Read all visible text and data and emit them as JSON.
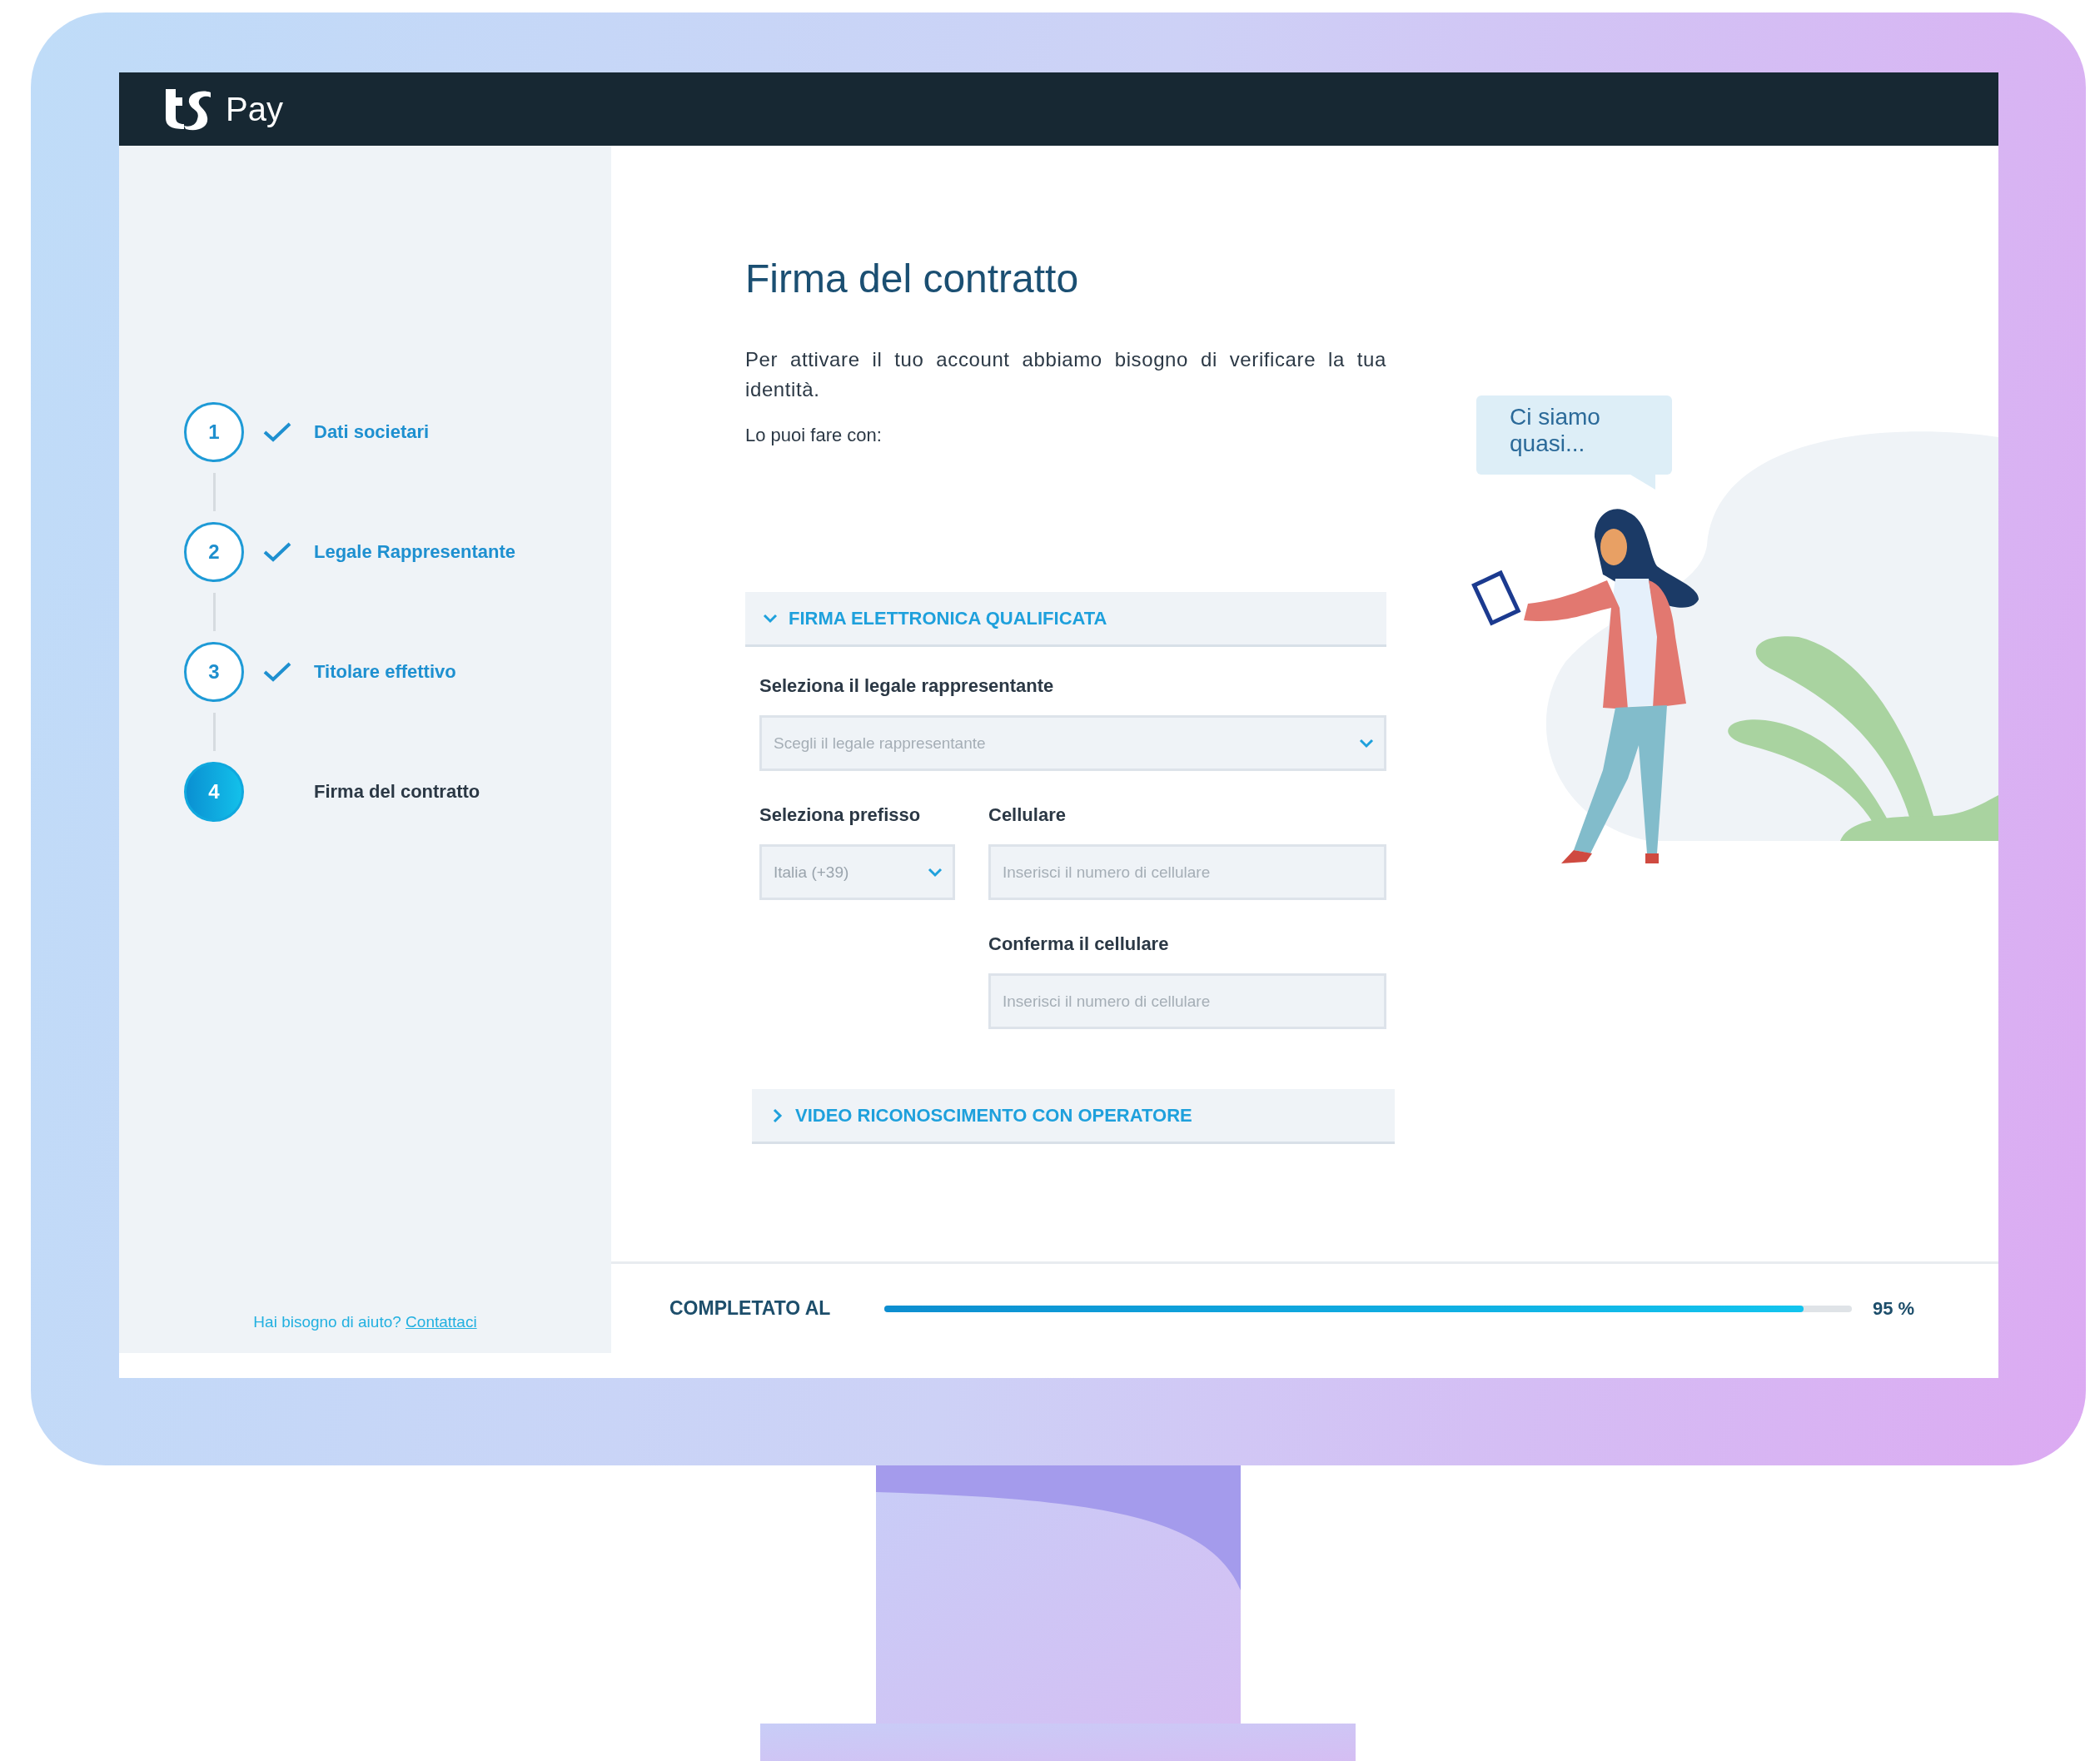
{
  "header": {
    "brand": "Pay"
  },
  "steps": [
    {
      "number": "1",
      "label": "Dati societari",
      "done": true,
      "selected": false
    },
    {
      "number": "2",
      "label": "Legale Rappresentante",
      "done": true,
      "selected": false
    },
    {
      "number": "3",
      "label": "Titolare effettivo",
      "done": true,
      "selected": false
    },
    {
      "number": "4",
      "label": "Firma del contratto",
      "done": false,
      "selected": true
    }
  ],
  "help": {
    "text": "Hai bisogno di aiuto?",
    "link": "Contattaci"
  },
  "page": {
    "title": "Firma del contratto",
    "intro": "Per attivare il tuo account abbiamo bisogno di verificare la tua identità.",
    "prompt": "Lo puoi fare con:"
  },
  "sections": [
    {
      "title": "FIRMA ELETTRONICA QUALIFICATA",
      "expanded": true,
      "representative": {
        "label": "Seleziona il legale rappresentante",
        "placeholder": "Scegli il legale rappresentante"
      },
      "prefix": {
        "label": "Seleziona prefisso",
        "value": "Italia (+39)"
      },
      "phone": {
        "label": "Cellulare",
        "placeholder": "Inserisci il numero di cellulare"
      },
      "confirm": {
        "label": "Conferma il cellulare",
        "placeholder": "Inserisci il numero di cellulare"
      }
    },
    {
      "title": "VIDEO RICONOSCIMENTO CON OPERATORE",
      "expanded": false
    }
  ],
  "bubble": {
    "text": "Ci siamo quasi..."
  },
  "progress": {
    "label": "COMPLETATO AL",
    "level": 0.95,
    "reading": "95 %"
  }
}
